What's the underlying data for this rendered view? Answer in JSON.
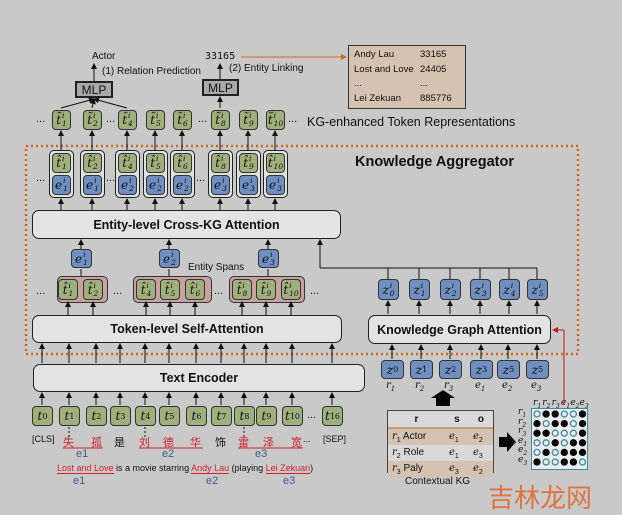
{
  "colors": {
    "background": "#c9c9c9",
    "token_green": "#9fb07c",
    "entity_blue": "#6f8fc0",
    "span_pink": "#c9a1a1",
    "aggregator_border": "#d06a1a",
    "kg_table": "#d5c2b0",
    "link_red": "#c01818",
    "matrix_border": "#3a8aa0"
  },
  "outputs": {
    "actor": "Actor",
    "relation_prediction": "(1) Relation Prediction",
    "entity_id": "33165",
    "entity_linking": "(2) Entity Linking",
    "mlp": "MLP"
  },
  "entity_table": [
    {
      "name": "Andy Lau",
      "id": "33165"
    },
    {
      "name": "Lost and Love",
      "id": "24405"
    },
    {
      "name": "...",
      "id": "..."
    },
    {
      "name": "Lei Zekuan",
      "id": "885776"
    }
  ],
  "kg_enhanced_label": "KG-enhanced Token Representations",
  "aggregator_title": "Knowledge Aggregator",
  "token_indices": [
    "1",
    "2",
    "4",
    "5",
    "6",
    "8",
    "9",
    "10"
  ],
  "token_entities": [
    "1",
    "1",
    "2",
    "2",
    "2",
    "3",
    "3",
    "3"
  ],
  "token_hat_base": "t̂",
  "token_tilde_base": "t̃",
  "entity_base": "e",
  "superscript": "i",
  "ellipsis": "...",
  "modules": {
    "cross_kg": "Entity-level Cross-KG Attention",
    "self_attention": "Token-level Self-Attention",
    "text_encoder": "Text Encoder",
    "kga": "Knowledge Graph Attention"
  },
  "entity_spans_label": "Entity Spans",
  "span_groups": [
    [
      "1",
      "2"
    ],
    [
      "4",
      "5",
      "6"
    ],
    [
      "8",
      "9",
      "10"
    ]
  ],
  "span_entities": [
    "1",
    "2",
    "3"
  ],
  "input_tokens": [
    "0",
    "1",
    "2",
    "3",
    "4",
    "5",
    "6",
    "7",
    "8",
    "9",
    "10",
    "...",
    "16"
  ],
  "chars": [
    "[CLS]",
    "失",
    "孤",
    "是",
    "刘",
    "德",
    "华",
    "饰",
    "雷",
    "泽",
    "宽",
    "...",
    "[SEP]"
  ],
  "char_entities": [
    false,
    true,
    true,
    false,
    true,
    true,
    true,
    false,
    true,
    true,
    true,
    false,
    false
  ],
  "char_entity_labels": [
    "e1",
    "e2",
    "e3"
  ],
  "sentence": [
    {
      "text": "Lost and Love",
      "entity": true
    },
    {
      "text": " is a movie starring ",
      "entity": false
    },
    {
      "text": "Andy Lau",
      "entity": true
    },
    {
      "text": " (playing ",
      "entity": false
    },
    {
      "text": "Lei Zekuan",
      "entity": true
    },
    {
      "text": ")",
      "entity": false
    }
  ],
  "sentence_entity_labels": [
    "e1",
    "e2",
    "e3"
  ],
  "z_out": [
    "0",
    "1",
    "2",
    "3",
    "4",
    "5"
  ],
  "z_in": [
    "0",
    "1",
    "2",
    "3",
    "5",
    "5"
  ],
  "z_in_labels": [
    [
      "r",
      "1"
    ],
    [
      "r",
      "2"
    ],
    [
      "r",
      "3"
    ],
    [
      "e",
      "1"
    ],
    [
      "e",
      "2"
    ],
    [
      "e",
      "3"
    ]
  ],
  "contextual_kg": {
    "headers": [
      "r",
      "s",
      "o"
    ],
    "rows": [
      {
        "r": "1",
        "rel": "Actor",
        "s": "1",
        "o": "2"
      },
      {
        "r": "2",
        "rel": "Role",
        "s": "1",
        "o": "3"
      },
      {
        "r": "3",
        "rel": "Paly",
        "s": "3",
        "o": "2"
      }
    ],
    "caption": "Contextual KG"
  },
  "matrix": {
    "labels": [
      [
        "r",
        "1"
      ],
      [
        "r",
        "2"
      ],
      [
        "r",
        "3"
      ],
      [
        "e",
        "1"
      ],
      [
        "e",
        "2"
      ],
      [
        "e",
        "3"
      ]
    ],
    "cells": [
      [
        0,
        1,
        1,
        0,
        0,
        1
      ],
      [
        1,
        0,
        1,
        1,
        0,
        1
      ],
      [
        1,
        1,
        0,
        0,
        0,
        1
      ],
      [
        0,
        0,
        1,
        0,
        1,
        1
      ],
      [
        0,
        1,
        0,
        1,
        1,
        1
      ],
      [
        1,
        0,
        0,
        1,
        1,
        0
      ]
    ]
  },
  "watermark": "吉林龙网"
}
